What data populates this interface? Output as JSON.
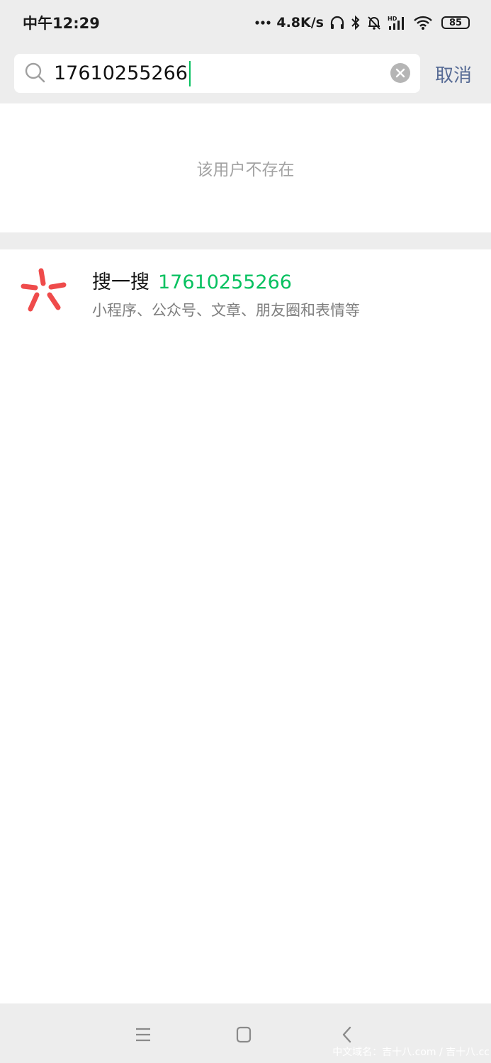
{
  "status_bar": {
    "time": "中午12:29",
    "network_speed": "4.8K/s",
    "battery": "85",
    "icons": [
      "dots-icon",
      "headphones-icon",
      "bluetooth-icon",
      "bell-muted-icon",
      "hd-signal-icon",
      "wifi-icon",
      "battery-icon"
    ]
  },
  "search": {
    "query": "17610255266",
    "icon": "search-icon",
    "clear_icon": "clear-icon",
    "cancel_label": "取消"
  },
  "empty_message": "该用户不存在",
  "search_one": {
    "icon": "sousou-icon",
    "label": "搜一搜",
    "keyword": "17610255266",
    "subtitle": "小程序、公众号、文章、朋友圈和表情等"
  },
  "nav_bar": {
    "icons": [
      "menu-icon",
      "home-icon",
      "back-icon"
    ],
    "watermark": "中文域名：吉十八.com / 吉十八.cc"
  },
  "colors": {
    "accent_green": "#07c160",
    "link_blue": "#576b95",
    "sousou_red": "#ef4b4b",
    "background_gray": "#ededed"
  }
}
